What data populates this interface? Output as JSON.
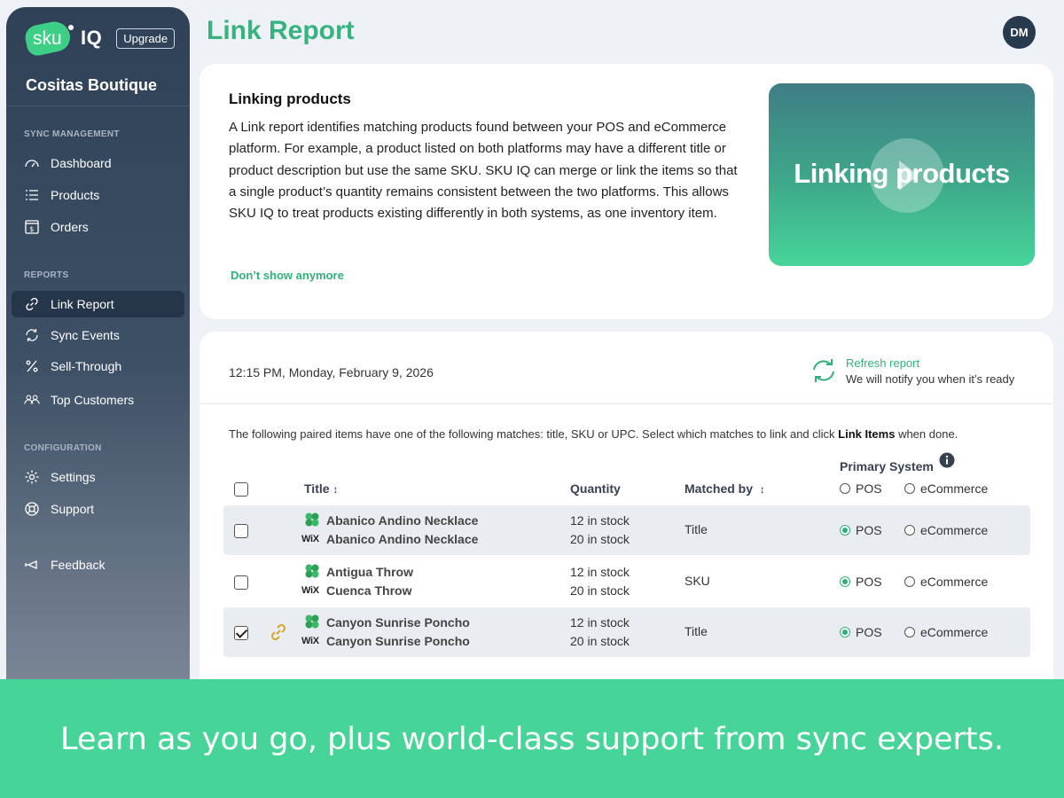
{
  "brand": {
    "logo_sku": "sku",
    "logo_iq": "IQ",
    "upgrade_label": "Upgrade"
  },
  "store_name": "Cositas Boutique",
  "sidebar": {
    "sections": [
      {
        "label": "SYNC MANAGEMENT",
        "items": [
          {
            "label": "Dashboard",
            "icon": "gauge-icon"
          },
          {
            "label": "Products",
            "icon": "list-icon"
          },
          {
            "label": "Orders",
            "icon": "receipt-icon"
          }
        ]
      },
      {
        "label": "REPORTS",
        "items": [
          {
            "label": "Link Report",
            "icon": "link-icon",
            "active": true
          },
          {
            "label": "Sync Events",
            "icon": "sync-icon"
          },
          {
            "label": "Sell-Through",
            "icon": "percent-icon"
          },
          {
            "label": "Top Customers",
            "icon": "users-icon"
          }
        ]
      },
      {
        "label": "CONFIGURATION",
        "items": [
          {
            "label": "Settings",
            "icon": "gear-icon"
          },
          {
            "label": "Support",
            "icon": "lifebuoy-icon"
          }
        ]
      }
    ],
    "feedback_label": "Feedback"
  },
  "header": {
    "title": "Link Report",
    "avatar_initials": "DM"
  },
  "info_card": {
    "heading": "Linking products",
    "body": "A Link report identifies matching products found between your POS and eCommerce platform. For example, a product listed on both platforms may have a different title or product description but use the same SKU. SKU IQ can merge or link the items so that a single product’s quantity remains consistent between the two platforms. This allows SKU IQ to treat products existing differently in both systems, as one inventory item.",
    "dismiss_label": "Don’t show anymore",
    "video_title": "Linking products"
  },
  "report": {
    "timestamp": "12:15 PM, Monday, February 9, 2026",
    "refresh_label": "Refresh report",
    "refresh_note": "We will notify you when it’s ready",
    "intro_prefix": "The following paired items have one of the following matches: title, SKU or UPC. Select which matches to link and click ",
    "intro_bold": "Link Items",
    "intro_suffix": " when done.",
    "columns": {
      "title": "Title",
      "quantity": "Quantity",
      "matched_by": "Matched by",
      "primary_system": "Primary System"
    },
    "sort_glyph": "↕",
    "radio_pos": "POS",
    "radio_ecom": "eCommerce",
    "wix_label": "WiX",
    "rows": [
      {
        "pos_title": "Abanico Andino Necklace",
        "ecom_title": "Abanico Andino Necklace",
        "pos_qty": "12 in stock",
        "ecom_qty": "20 in stock",
        "matched_by": "Title",
        "checked": false,
        "linked": false,
        "primary": "POS"
      },
      {
        "pos_title": "Antigua Throw",
        "ecom_title": "Cuenca Throw",
        "pos_qty": "12 in stock",
        "ecom_qty": "20 in stock",
        "matched_by": "SKU",
        "checked": false,
        "linked": false,
        "primary": "POS"
      },
      {
        "pos_title": "Canyon Sunrise Poncho",
        "ecom_title": "Canyon Sunrise Poncho",
        "pos_qty": "12 in stock",
        "ecom_qty": "20 in stock",
        "matched_by": "Title",
        "checked": true,
        "linked": true,
        "primary": "POS"
      }
    ]
  },
  "banner": "Learn as you go, plus world-class support from sync experts.",
  "colors": {
    "accent": "#36b37e",
    "sidebar": "#2f4156",
    "banner": "#47d498"
  }
}
